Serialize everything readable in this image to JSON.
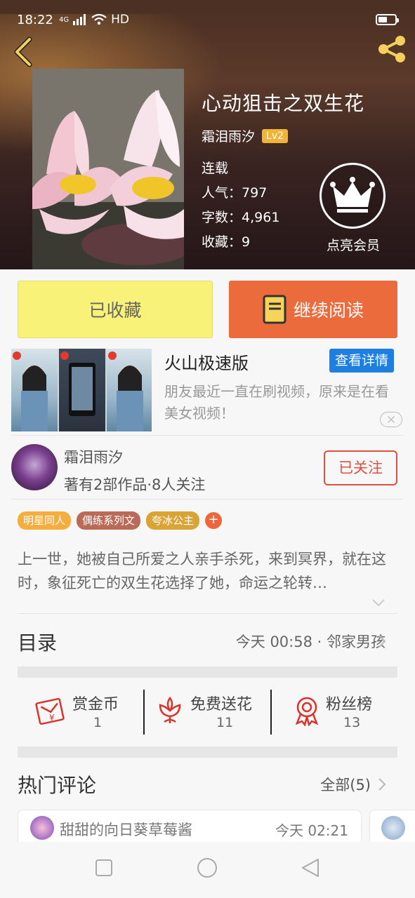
{
  "status_bar": {
    "time": "18:22",
    "network": "4G",
    "hd": "HD"
  },
  "book": {
    "title": "心动狙击之双生花",
    "author": "霜泪雨汐",
    "level": "Lv2",
    "status": "连载",
    "popularity_label": "人气：",
    "popularity": "797",
    "words_label": "字数：",
    "words": "4,961",
    "favorites_label": "收藏：",
    "favorites": "9"
  },
  "vip": {
    "label": "点亮会员"
  },
  "actions": {
    "collected": "已收藏",
    "continue_reading": "继续阅读"
  },
  "ad": {
    "title": "火山极速版",
    "detail_button": "查看详情",
    "description": "朋友最近一直在刷视频，原来是在看美女视频！"
  },
  "author_block": {
    "name": "霜泪雨汐",
    "stats": "著有2部作品·8人关注",
    "follow_button": "已关注"
  },
  "tags": [
    {
      "label": "明星同人",
      "color": "#f5ae3c"
    },
    {
      "label": "偶练系列文",
      "color": "#bb6a57"
    },
    {
      "label": "夸冰公主",
      "color": "#d9a434"
    }
  ],
  "synopsis": "上一世，她被自己所爱之人亲手杀死，来到冥界，就在这时，象征死亡的双生花选择了她，命运之轮转…",
  "catalog": {
    "title": "目录",
    "update": "今天 00:58 · 邻家男孩"
  },
  "stats": [
    {
      "label": "赏金币",
      "value": "1",
      "icon": "red-envelope-icon"
    },
    {
      "label": "免费送花",
      "value": "11",
      "icon": "flower-icon"
    },
    {
      "label": "粉丝榜",
      "value": "13",
      "icon": "medal-icon"
    }
  ],
  "hot_comments": {
    "title": "热门评论",
    "all_label": "全部(5)",
    "items": [
      {
        "user": "甜甜的向日葵草莓酱",
        "time": "今天 02:21"
      }
    ]
  },
  "colors": {
    "accent_orange": "#ec6b3d",
    "collected_yellow": "#f9f279",
    "follow_red": "#e04f3e",
    "ad_blue": "#1e7fe0",
    "icon_red": "#d9332b"
  }
}
